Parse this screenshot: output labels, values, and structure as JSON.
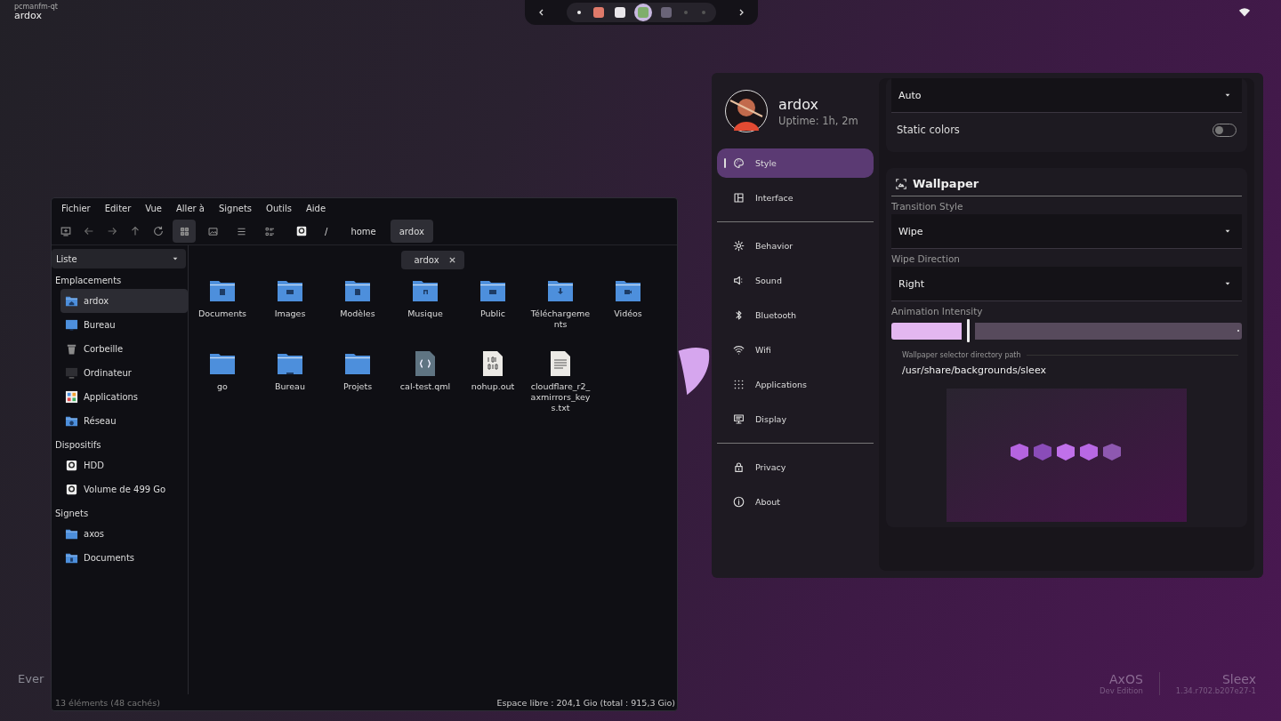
{
  "top_bar": {
    "app_class": "pcmanfm-qt",
    "window_title": "ardox"
  },
  "dock": {
    "items": [
      {
        "kind": "workspace",
        "selected": true
      },
      {
        "kind": "app",
        "color": "#e07a6a",
        "selected": false
      },
      {
        "kind": "app",
        "color": "#e9e6ea",
        "selected": false
      },
      {
        "kind": "app",
        "color": "#7fae6c",
        "selected": true
      },
      {
        "kind": "app",
        "color": "#6a6478",
        "selected": false
      },
      {
        "kind": "workspace",
        "selected": false
      },
      {
        "kind": "workspace",
        "selected": false
      }
    ]
  },
  "desktop_label": "Ever",
  "file_manager": {
    "menu": [
      "Fichier",
      "Editer",
      "Vue",
      "Aller à",
      "Signets",
      "Outils",
      "Aide"
    ],
    "view_modes": [
      {
        "selected": true
      },
      {
        "selected": false
      },
      {
        "selected": false
      },
      {
        "selected": false
      }
    ],
    "path": [
      {
        "label": "/",
        "selected": false
      },
      {
        "label": "home",
        "selected": false
      },
      {
        "label": "ardox",
        "selected": true
      }
    ],
    "sidebar": {
      "view": "Liste",
      "sections": [
        {
          "title": "Emplacements",
          "items": [
            {
              "label": "ardox",
              "kind": "home",
              "selected": true
            },
            {
              "label": "Bureau",
              "kind": "desktop",
              "selected": false
            },
            {
              "label": "Corbeille",
              "kind": "trash",
              "selected": false
            },
            {
              "label": "Ordinateur",
              "kind": "computer",
              "selected": false
            },
            {
              "label": "Applications",
              "kind": "apps",
              "selected": false
            },
            {
              "label": "Réseau",
              "kind": "network",
              "selected": false
            }
          ]
        },
        {
          "title": "Dispositifs",
          "items": [
            {
              "label": "HDD",
              "kind": "drive",
              "selected": false
            },
            {
              "label": "Volume de 499 Go",
              "kind": "drive",
              "selected": false
            }
          ]
        },
        {
          "title": "Signets",
          "items": [
            {
              "label": "axos",
              "kind": "folder",
              "selected": false
            },
            {
              "label": "Documents",
              "kind": "documents",
              "selected": false
            }
          ]
        }
      ]
    },
    "tab": {
      "label": "ardox"
    },
    "files": [
      {
        "name": "Documents",
        "kind": "documents"
      },
      {
        "name": "Images",
        "kind": "images"
      },
      {
        "name": "Modèles",
        "kind": "templates"
      },
      {
        "name": "Musique",
        "kind": "music"
      },
      {
        "name": "Public",
        "kind": "public"
      },
      {
        "name": "Téléchargements",
        "kind": "downloads"
      },
      {
        "name": "Vidéos",
        "kind": "videos"
      },
      {
        "name": "go",
        "kind": "folder"
      },
      {
        "name": "Bureau",
        "kind": "desktop"
      },
      {
        "name": "Projets",
        "kind": "folder"
      },
      {
        "name": "cal-test.qml",
        "kind": "code"
      },
      {
        "name": "nohup.out",
        "kind": "binary"
      },
      {
        "name": "cloudflare_r2_axmirrors_keys.txt",
        "kind": "text"
      }
    ],
    "status_left": "13 éléments (48 cachés)",
    "status_right": "Espace libre : 204,1 Gio (total : 915,3 Gio)"
  },
  "settings": {
    "profile": {
      "name": "ardox",
      "uptime": "Uptime: 1h, 2m"
    },
    "nav_groups": [
      {
        "items": [
          {
            "label": "Style",
            "kind": "palette",
            "selected": true
          },
          {
            "label": "Interface",
            "kind": "layout",
            "selected": false
          }
        ]
      },
      {
        "items": [
          {
            "label": "Behavior",
            "kind": "gear",
            "selected": false
          },
          {
            "label": "Sound",
            "kind": "speaker",
            "selected": false
          },
          {
            "label": "Bluetooth",
            "kind": "bluetooth",
            "selected": false
          },
          {
            "label": "Wifi",
            "kind": "wifi",
            "selected": false
          },
          {
            "label": "Applications",
            "kind": "grid",
            "selected": false
          },
          {
            "label": "Display",
            "kind": "monitor",
            "selected": false
          }
        ]
      },
      {
        "items": [
          {
            "label": "Privacy",
            "kind": "lock",
            "selected": false
          },
          {
            "label": "About",
            "kind": "info",
            "selected": false
          }
        ]
      }
    ],
    "color_mode": {
      "value": "Auto"
    },
    "static_colors": {
      "label": "Static colors",
      "on": false
    },
    "wallpaper": {
      "title": "Wallpaper",
      "transition_style": {
        "label": "Transition Style",
        "value": "Wipe"
      },
      "wipe_direction": {
        "label": "Wipe Direction",
        "value": "Right"
      },
      "animation_intensity": {
        "label": "Animation Intensity",
        "level": 0.2
      },
      "directory_path": {
        "label": "Wallpaper selector directory path",
        "value": "/usr/share/backgrounds/sleex"
      }
    }
  },
  "branding": [
    {
      "title": "AxOS",
      "subtitle": "Dev Edition"
    },
    {
      "title": "Sleex",
      "subtitle": "1.34.r702.b207e27-1"
    }
  ]
}
